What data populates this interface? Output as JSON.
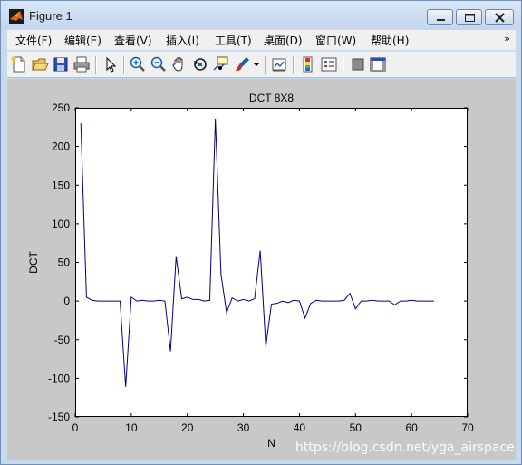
{
  "window": {
    "title": "Figure 1"
  },
  "menu": {
    "items": [
      {
        "label": "文件(F)"
      },
      {
        "label": "编辑(E)"
      },
      {
        "label": "查看(V)"
      },
      {
        "label": "插入(I)"
      },
      {
        "label": "工具(T)"
      },
      {
        "label": "桌面(D)"
      },
      {
        "label": "窗口(W)"
      },
      {
        "label": "帮助(H)"
      }
    ],
    "overflow_icon": "double-chevron-icon"
  },
  "toolbar": {
    "icons": [
      "new-figure-icon",
      "open-file-icon",
      "save-icon",
      "print-icon",
      "select-arrow-icon",
      "zoom-in-icon",
      "zoom-out-icon",
      "pan-hand-icon",
      "rotate-3d-icon",
      "data-cursor-icon",
      "brush-icon",
      "brush-dropdown-icon",
      "link-plot-icon",
      "colorbar-icon",
      "legend-icon",
      "hide-plot-tools-icon",
      "show-plot-tools-icon"
    ]
  },
  "chart_data": {
    "type": "line",
    "title": "DCT 8X8",
    "xlabel": "N",
    "ylabel": "DCT",
    "xlim": [
      0,
      70
    ],
    "ylim": [
      -150,
      250
    ],
    "xticks": [
      0,
      10,
      20,
      30,
      40,
      50,
      60,
      70
    ],
    "yticks": [
      -150,
      -100,
      -50,
      0,
      50,
      100,
      150,
      200,
      250
    ],
    "grid": false,
    "line_color": "#00007f",
    "series": [
      {
        "x": [
          1,
          2,
          3,
          4,
          5,
          6,
          7,
          8,
          9,
          10,
          11,
          12,
          13,
          14,
          15,
          16,
          17,
          18,
          19,
          20,
          21,
          22,
          23,
          24,
          25,
          26,
          27,
          28,
          29,
          30,
          31,
          32,
          33,
          34,
          35,
          36,
          37,
          38,
          39,
          40,
          41,
          42,
          43,
          44,
          45,
          46,
          47,
          48,
          49,
          50,
          51,
          52,
          53,
          54,
          55,
          56,
          57,
          58,
          59,
          60,
          61,
          62,
          63,
          64
        ],
        "values": [
          230,
          5,
          1,
          0,
          0,
          0,
          0,
          0,
          -111,
          5,
          0,
          1,
          0,
          0,
          1,
          0,
          -65,
          58,
          3,
          5,
          2,
          2,
          0,
          1,
          236,
          35,
          -15,
          4,
          0,
          2,
          0,
          3,
          65,
          -59,
          -4,
          -3,
          0,
          -2,
          1,
          0,
          -22,
          -3,
          1,
          0,
          0,
          0,
          0,
          1,
          10,
          -10,
          0,
          0,
          1,
          0,
          0,
          0,
          -5,
          0,
          0,
          1,
          0,
          0,
          0,
          0
        ]
      }
    ]
  },
  "watermark": "https://blog.csdn.net/yga_airspace"
}
